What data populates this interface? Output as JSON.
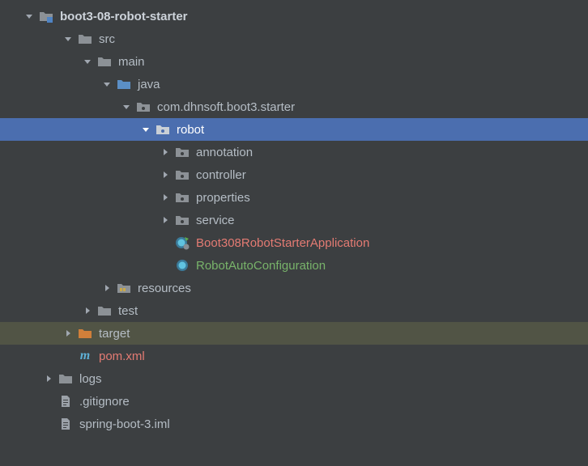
{
  "tree": {
    "root": {
      "label": "boot3-08-robot-starter"
    },
    "src": {
      "label": "src"
    },
    "main": {
      "label": "main"
    },
    "java": {
      "label": "java"
    },
    "pkg": {
      "label": "com.dhnsoft.boot3.starter"
    },
    "robot": {
      "label": "robot"
    },
    "annotation": {
      "label": "annotation"
    },
    "controller": {
      "label": "controller"
    },
    "properties": {
      "label": "properties"
    },
    "service": {
      "label": "service"
    },
    "app": {
      "label": "Boot308RobotStarterApplication"
    },
    "config": {
      "label": "RobotAutoConfiguration"
    },
    "resources": {
      "label": "resources"
    },
    "test": {
      "label": "test"
    },
    "target": {
      "label": "target"
    },
    "pom": {
      "label": "pom.xml"
    },
    "logs": {
      "label": "logs"
    },
    "gitignore": {
      "label": ".gitignore"
    },
    "iml": {
      "label": "spring-boot-3.iml"
    }
  },
  "colors": {
    "folder_gray": "#8c9196",
    "folder_blue": "#5b8fc6",
    "folder_orange": "#d07f3a",
    "class_ring": "#3b7a99",
    "class_fill": "#2b5f78"
  }
}
